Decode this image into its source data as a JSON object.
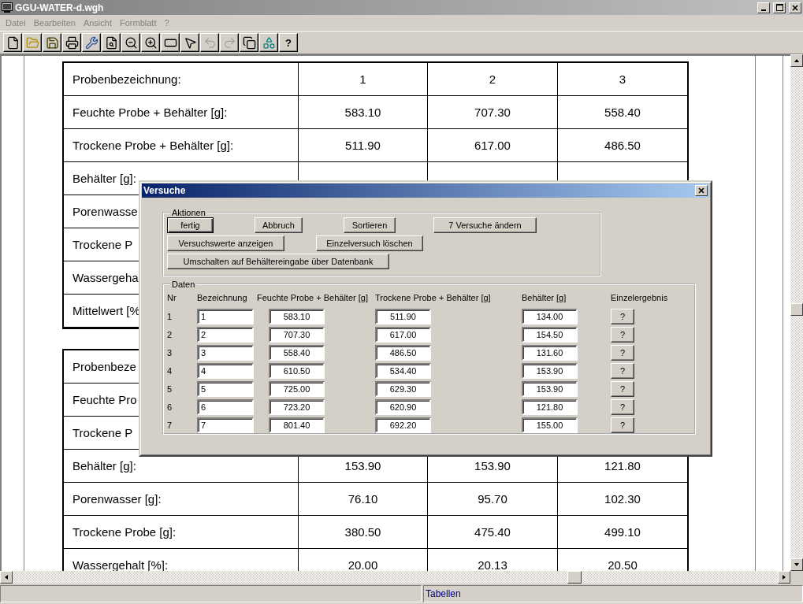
{
  "window": {
    "title": "GGU-WATER-d.wgh"
  },
  "menu": [
    {
      "label": "Datei"
    },
    {
      "label": "Bearbeiten"
    },
    {
      "label": "Ansicht"
    },
    {
      "label": "Formblatt"
    },
    {
      "label": "?"
    }
  ],
  "toolbar": [
    {
      "kind": "new",
      "disabled": false
    },
    {
      "kind": "open",
      "disabled": false
    },
    {
      "kind": "save",
      "disabled": false
    },
    {
      "kind": "print",
      "disabled": false
    },
    {
      "kind": "tool",
      "disabled": false
    },
    {
      "kind": "preview",
      "disabled": false
    },
    {
      "kind": "zoom-out",
      "disabled": false
    },
    {
      "kind": "zoom-in",
      "disabled": false
    },
    {
      "kind": "frame",
      "disabled": false
    },
    {
      "kind": "pointer",
      "disabled": false
    },
    {
      "kind": "undo",
      "disabled": true
    },
    {
      "kind": "redo",
      "disabled": true
    },
    {
      "kind": "copy",
      "disabled": false
    },
    {
      "kind": "shapes",
      "disabled": false
    },
    {
      "kind": "help",
      "label": "?",
      "disabled": false
    }
  ],
  "document": {
    "tables": [
      {
        "rows": [
          {
            "label": "Probenbezeichnung:",
            "values": [
              "1",
              "2",
              "3"
            ]
          },
          {
            "label": "Feuchte Probe + Behälter [g]:",
            "values": [
              "583.10",
              "707.30",
              "558.40"
            ]
          },
          {
            "label": "Trockene Probe + Behälter [g]:",
            "values": [
              "511.90",
              "617.00",
              "486.50"
            ]
          },
          {
            "label": "Behälter [g]:",
            "values": []
          },
          {
            "label": "Porenwasse",
            "values": []
          },
          {
            "label": "Trockene P",
            "values": []
          },
          {
            "label": "Wassergeha",
            "values": []
          },
          {
            "label": "Mittelwert [%",
            "values": []
          }
        ]
      },
      {
        "rows": [
          {
            "label": "Probenbeze",
            "values": []
          },
          {
            "label": "Feuchte Pro",
            "values": []
          },
          {
            "label": "Trockene P",
            "values": []
          },
          {
            "label": "Behälter [g]:",
            "values": [
              "153.90",
              "153.90",
              "121.80"
            ]
          },
          {
            "label": "Porenwasser [g]:",
            "values": [
              "76.10",
              "95.70",
              "102.30"
            ]
          },
          {
            "label": "Trockene Probe [g]:",
            "values": [
              "380.50",
              "475.40",
              "499.10"
            ]
          },
          {
            "label": "Wassergehalt [%]:",
            "values": [
              "20.00",
              "20.13",
              "20.50"
            ]
          }
        ]
      }
    ]
  },
  "dialog": {
    "title": "Versuche",
    "actions": {
      "title": "Aktionen",
      "buttons": [
        {
          "label": "fertig",
          "default": true
        },
        {
          "label": "Abbruch",
          "default": false
        },
        {
          "label": "Sortieren",
          "default": false
        },
        {
          "label": "7 Versuche ändern",
          "default": false
        },
        {
          "label": "Versuchswerte anzeigen",
          "default": false
        },
        {
          "label": "Einzelversuch löschen",
          "default": false
        },
        {
          "label": "Umschalten auf Behältereingabe über Datenbank",
          "default": false
        }
      ]
    },
    "data": {
      "title": "Daten",
      "headers": [
        "Nr",
        "Bezeichnung",
        "Feuchte Probe + Behälter [g]",
        "Trockene Probe + Behälter [g]",
        "Behälter [g]",
        "Einzelergebnis"
      ],
      "rows": [
        {
          "nr": "1",
          "name": "1",
          "wet": "583.10",
          "dry": "511.90",
          "container": "134.00",
          "result": "?"
        },
        {
          "nr": "2",
          "name": "2",
          "wet": "707.30",
          "dry": "617.00",
          "container": "154.50",
          "result": "?"
        },
        {
          "nr": "3",
          "name": "3",
          "wet": "558.40",
          "dry": "486.50",
          "container": "131.60",
          "result": "?"
        },
        {
          "nr": "4",
          "name": "4",
          "wet": "610.50",
          "dry": "534.40",
          "container": "153.90",
          "result": "?"
        },
        {
          "nr": "5",
          "name": "5",
          "wet": "725.00",
          "dry": "629.30",
          "container": "153.90",
          "result": "?"
        },
        {
          "nr": "6",
          "name": "6",
          "wet": "723.20",
          "dry": "620.90",
          "container": "121.80",
          "result": "?"
        },
        {
          "nr": "7",
          "name": "7",
          "wet": "801.40",
          "dry": "692.20",
          "container": "155.00",
          "result": "?"
        }
      ]
    }
  },
  "status_bar": {
    "text": "Tabellen"
  }
}
